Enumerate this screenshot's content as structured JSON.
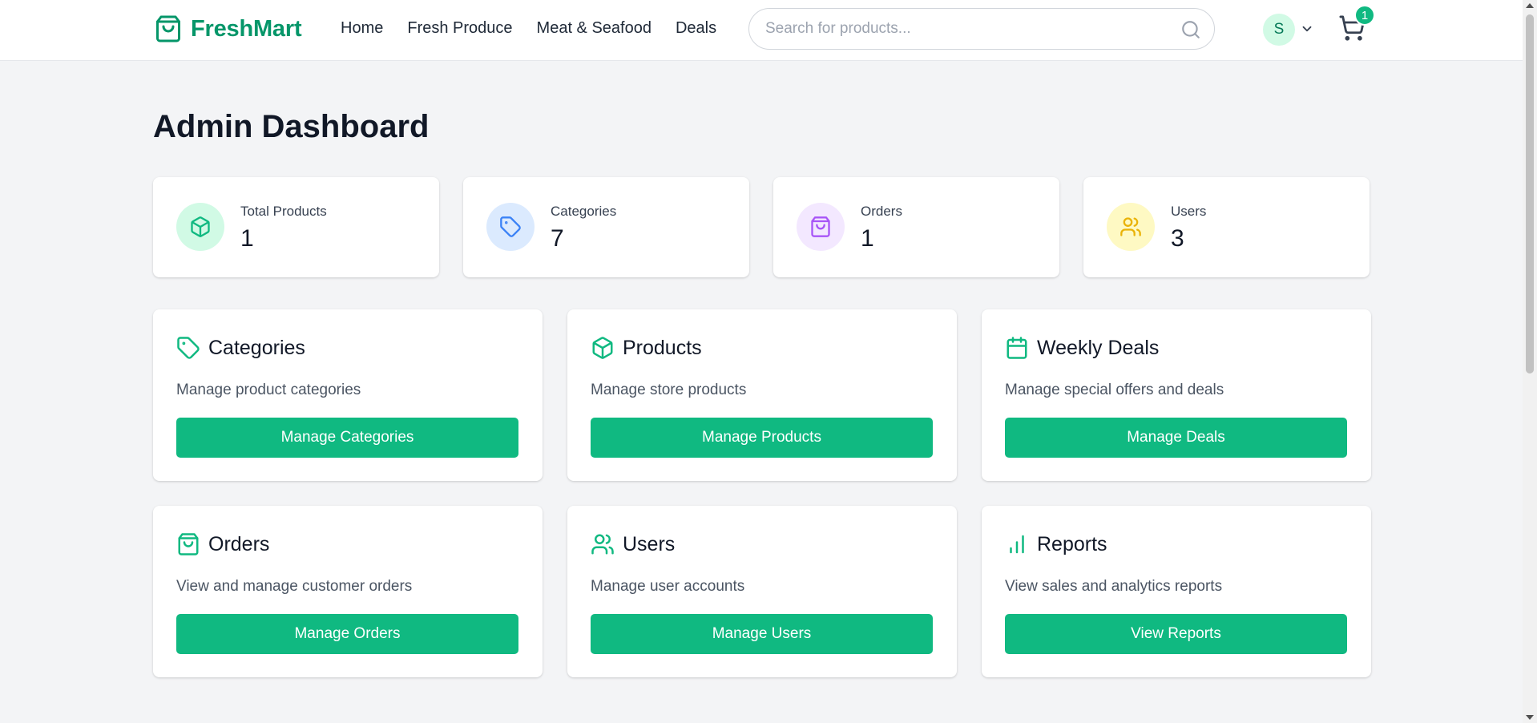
{
  "brand": {
    "name": "FreshMart",
    "accent": "#059669",
    "button_color": "#10b981"
  },
  "nav": [
    "Home",
    "Fresh Produce",
    "Meat & Seafood",
    "Deals"
  ],
  "search": {
    "placeholder": "Search for products..."
  },
  "user": {
    "initial": "S"
  },
  "cart": {
    "count": "1"
  },
  "page": {
    "title": "Admin Dashboard"
  },
  "stats": [
    {
      "label": "Total Products",
      "value": "1",
      "icon": "box-icon",
      "bg": "#d1fae5",
      "fg": "#10b981"
    },
    {
      "label": "Categories",
      "value": "7",
      "icon": "tag-icon",
      "bg": "#dbeafe",
      "fg": "#3b82f6"
    },
    {
      "label": "Orders",
      "value": "1",
      "icon": "shopping-bag-icon",
      "bg": "#f3e8ff",
      "fg": "#a855f7"
    },
    {
      "label": "Users",
      "value": "3",
      "icon": "users-icon",
      "bg": "#fef9c3",
      "fg": "#eab308"
    }
  ],
  "cards": [
    {
      "title": "Categories",
      "desc": "Manage product categories",
      "button": "Manage Categories",
      "icon": "tag-icon"
    },
    {
      "title": "Products",
      "desc": "Manage store products",
      "button": "Manage Products",
      "icon": "box-icon"
    },
    {
      "title": "Weekly Deals",
      "desc": "Manage special offers and deals",
      "button": "Manage Deals",
      "icon": "calendar-icon"
    },
    {
      "title": "Orders",
      "desc": "View and manage customer orders",
      "button": "Manage Orders",
      "icon": "shopping-bag-icon"
    },
    {
      "title": "Users",
      "desc": "Manage user accounts",
      "button": "Manage Users",
      "icon": "users-icon"
    },
    {
      "title": "Reports",
      "desc": "View sales and analytics reports",
      "button": "View Reports",
      "icon": "bar-chart-icon"
    }
  ]
}
